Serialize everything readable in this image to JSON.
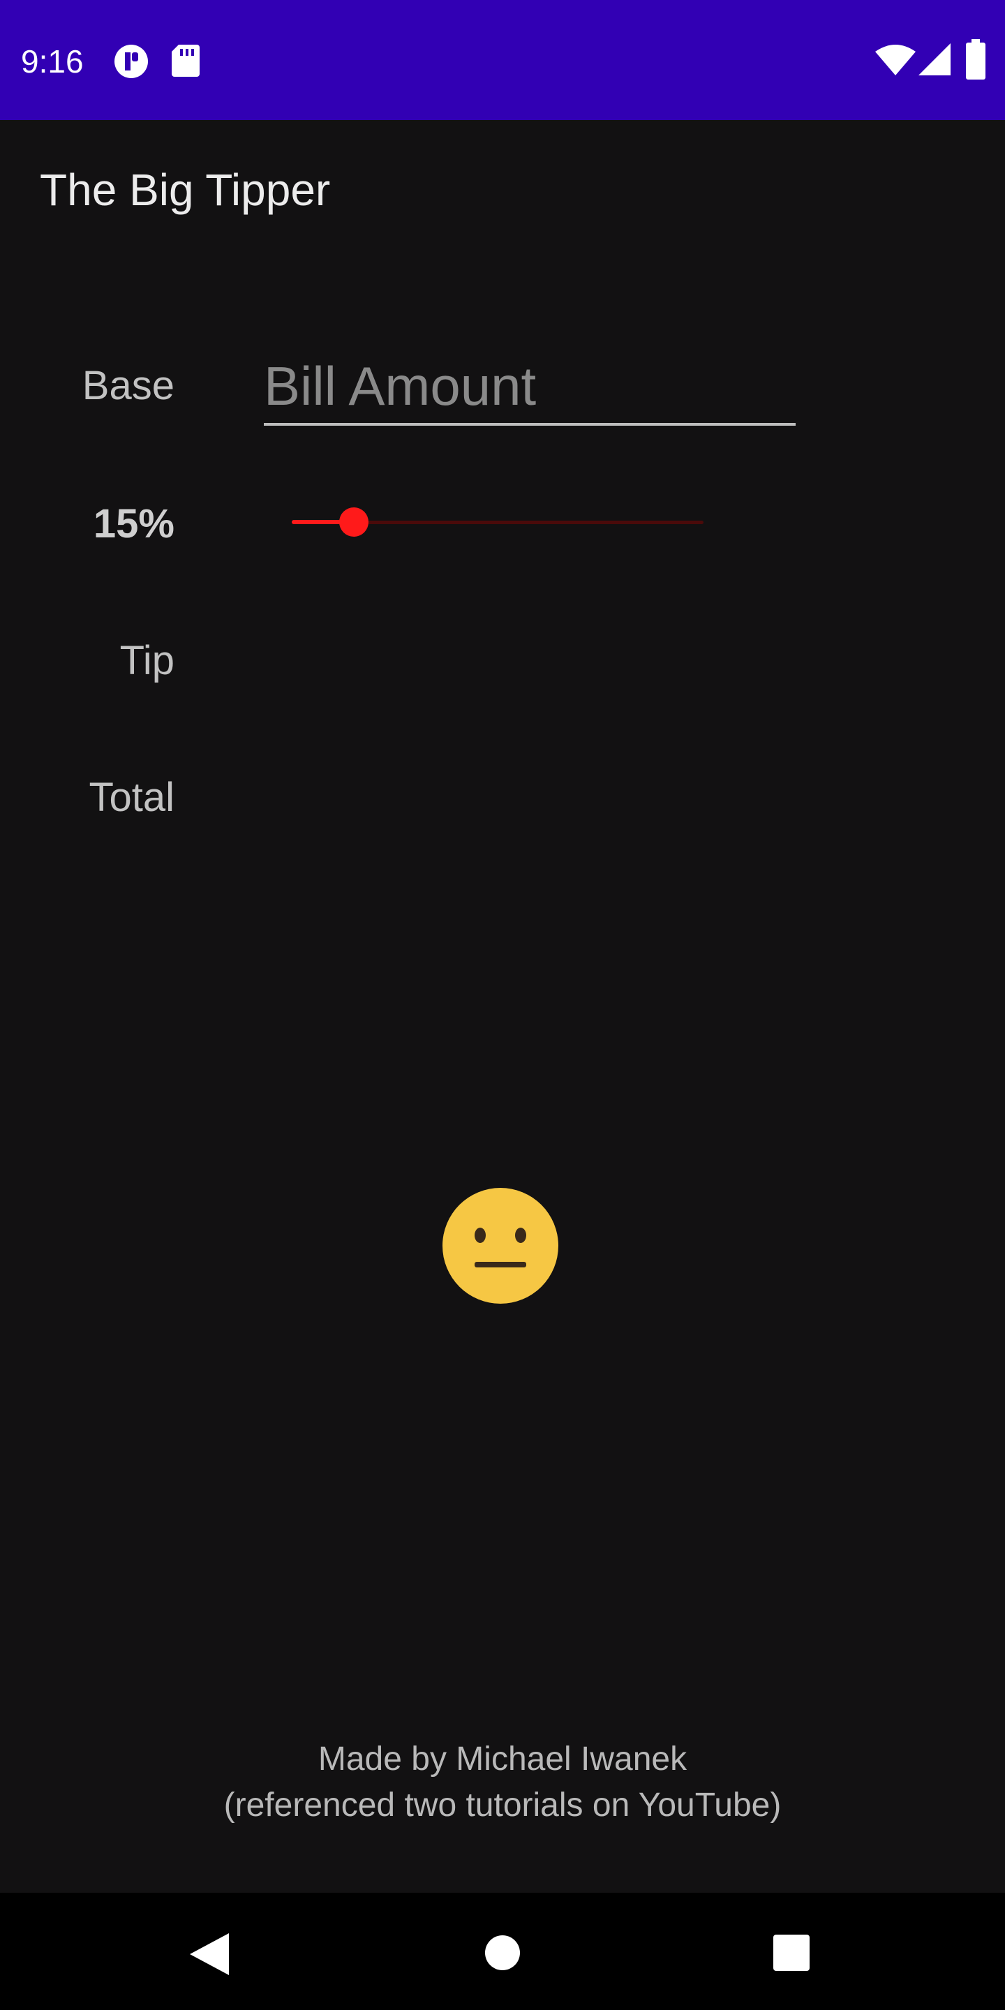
{
  "status_bar": {
    "time": "9:16",
    "left_icons": [
      "app-notification-icon",
      "sd-card-icon"
    ],
    "right_icons": [
      "wifi-icon",
      "signal-icon",
      "battery-icon"
    ],
    "background": "#3200b4"
  },
  "app": {
    "title": "The Big Tipper"
  },
  "form": {
    "base_label": "Base",
    "bill_placeholder": "Bill Amount",
    "bill_value": "",
    "tip_percent_label": "15%",
    "tip_percent_value": 15,
    "slider_max": 100,
    "tip_label": "Tip",
    "tip_value": "",
    "total_label": "Total",
    "total_value": ""
  },
  "slider_colors": {
    "active": "#ff1a1a",
    "inactive": "#4a0a0a"
  },
  "emoji": {
    "icon": "neutral-face-icon",
    "color": "#f6c744"
  },
  "footer": {
    "line1": "Made by Michael Iwanek",
    "line2": "(referenced two tutorials on YouTube)"
  },
  "nav_bar": {
    "icons": [
      "back-icon",
      "home-icon",
      "recents-icon"
    ]
  }
}
